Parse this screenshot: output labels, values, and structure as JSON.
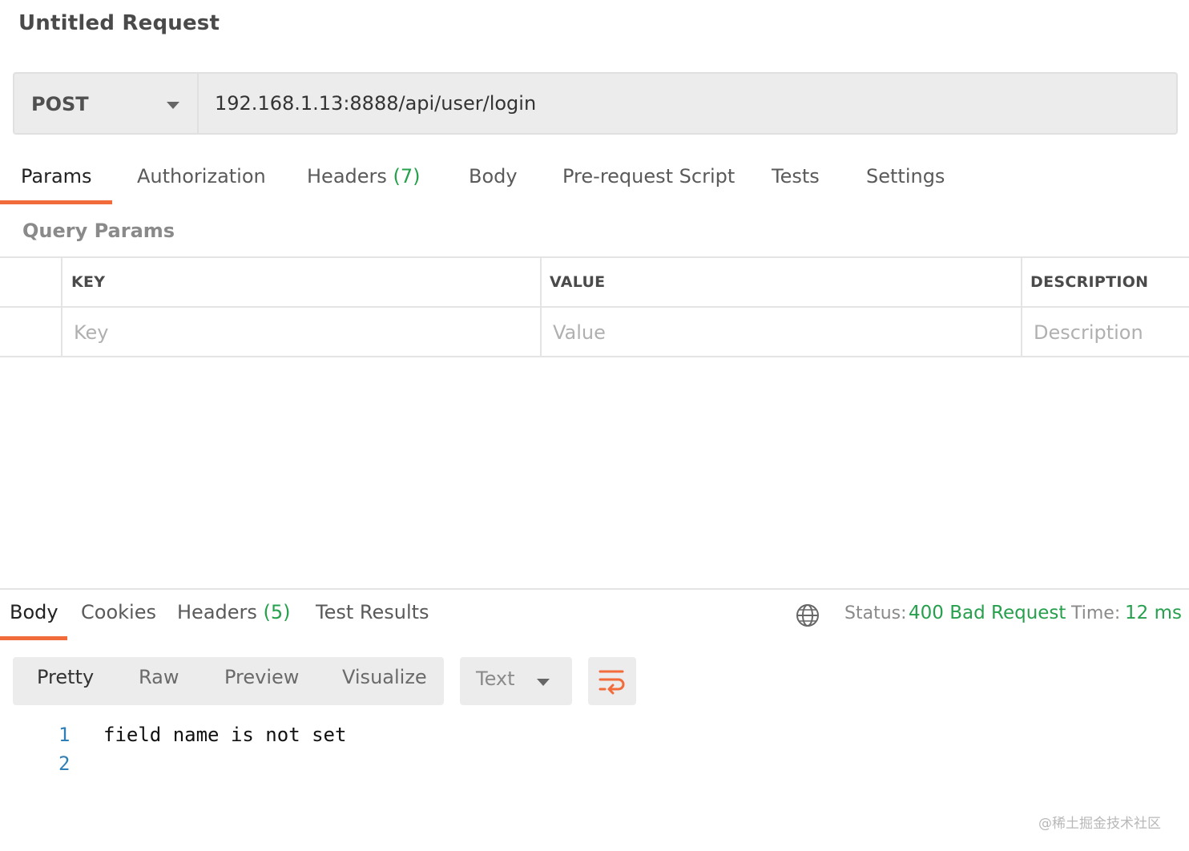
{
  "request": {
    "title": "Untitled Request",
    "method": "POST",
    "url": "192.168.1.13:8888/api/user/login"
  },
  "request_tabs": [
    {
      "label": "Params",
      "count": ""
    },
    {
      "label": "Authorization",
      "count": ""
    },
    {
      "label": "Headers",
      "count": "(7)"
    },
    {
      "label": "Body",
      "count": ""
    },
    {
      "label": "Pre-request Script",
      "count": ""
    },
    {
      "label": "Tests",
      "count": ""
    },
    {
      "label": "Settings",
      "count": ""
    }
  ],
  "query_params": {
    "title": "Query Params",
    "columns": [
      "KEY",
      "VALUE",
      "DESCRIPTION"
    ],
    "placeholders": {
      "key": "Key",
      "value": "Value",
      "description": "Description"
    }
  },
  "response_tabs": [
    {
      "label": "Body",
      "count": ""
    },
    {
      "label": "Cookies",
      "count": ""
    },
    {
      "label": "Headers",
      "count": "(5)"
    },
    {
      "label": "Test Results",
      "count": ""
    }
  ],
  "response_meta": {
    "status_label": "Status:",
    "status_value": "400 Bad Request",
    "time_label": "Time:",
    "time_value": "12 ms"
  },
  "view_modes": [
    "Pretty",
    "Raw",
    "Preview",
    "Visualize"
  ],
  "format": "Text",
  "response_body": [
    {
      "line": "1",
      "text": "field name is not set"
    },
    {
      "line": "2",
      "text": ""
    }
  ],
  "watermark": "@稀土掘金技术社区",
  "colors": {
    "accent": "#f26b3a",
    "success": "#26a04d"
  },
  "icons": {
    "method_caret": "chevron-down-icon",
    "globe": "globe-icon",
    "format_caret": "chevron-down-icon",
    "wrap": "wrap-lines-icon"
  }
}
